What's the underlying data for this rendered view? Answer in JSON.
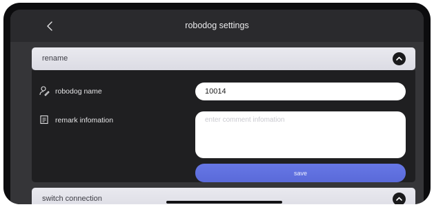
{
  "header": {
    "title": "robodog settings",
    "back_icon": "chevron-left-icon"
  },
  "sections": {
    "rename": {
      "label": "rename",
      "toggle_icon": "chevron-up-icon",
      "name_label": "robodog name",
      "name_icon": "user-edit-icon",
      "name_value": "10014",
      "remark_label": "remark infomation",
      "remark_icon": "note-icon",
      "remark_placeholder": "enter comment infomation",
      "save_label": "save"
    },
    "switch_connection": {
      "label": "switch connection",
      "toggle_icon": "chevron-up-icon"
    }
  },
  "colors": {
    "accent": "#5a6ad9",
    "screen_bg": "#353538",
    "panel_bg": "#1f1f21"
  }
}
